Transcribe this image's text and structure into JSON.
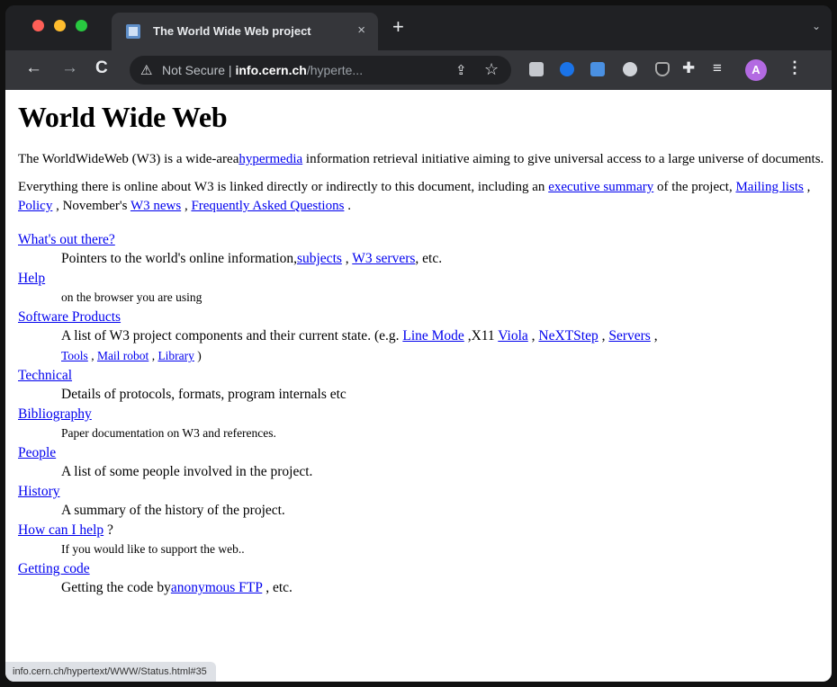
{
  "browser": {
    "tab_title": "The World Wide Web project",
    "tab_close": "×",
    "new_tab": "+",
    "tab_search": "⌄",
    "omnibox": {
      "warning_icon": "warning-triangle-icon",
      "not_secure": "Not Secure",
      "separator": " | ",
      "host": "info.cern.ch",
      "path": "/hyperte..."
    },
    "avatar_letter": "A"
  },
  "page": {
    "title": "World Wide Web",
    "intro": {
      "t1": "The WorldWideWeb (W3) is a wide-area",
      "link_hypermedia": "hypermedia",
      "t2": " information retrieval initiative aiming to give universal access to a large universe of documents."
    },
    "para2": {
      "t1": "Everything there is online about W3 is linked directly or indirectly to this document, including an ",
      "link_exec": "executive summary",
      "t2": " of the project, ",
      "link_mailing": "Mailing lists",
      "t3": " , ",
      "link_policy": "Policy",
      "t4": " , November's ",
      "link_news": "W3 news",
      "t5": " , ",
      "link_faq": "Frequently Asked Questions",
      "t6": " ."
    },
    "items": [
      {
        "label": "What's out there?"
      },
      {
        "label": "Help",
        "desc": "on the browser you are using"
      },
      {
        "label": "Software Products"
      },
      {
        "label": "Technical",
        "desc": "Details of protocols, formats, program internals etc"
      },
      {
        "label": "Bibliography",
        "desc": "Paper documentation on W3 and references."
      },
      {
        "label": "People",
        "desc": "A list of some people involved in the project."
      },
      {
        "label": "History",
        "desc": "A summary of the history of the project."
      },
      {
        "label": "How can I help",
        "after": " ?",
        "desc": "If you would like to support the web.."
      },
      {
        "label": "Getting code"
      }
    ],
    "whats_out": {
      "t1": "Pointers to the world's online information,",
      "link_subjects": "subjects",
      "t2": " , ",
      "link_servers": "W3 servers",
      "t3": ", etc."
    },
    "software": {
      "t1": "A list of W3 project components and their current state. (e.g. ",
      "link_linemode": "Line Mode",
      "t2": " ,X11 ",
      "link_viola": "Viola",
      "t3": " , ",
      "link_nextstep": "NeXTStep",
      "t4": " , ",
      "link_servers": "Servers",
      "t5": " , ",
      "link_tools": "Tools",
      "t6": " , ",
      "link_mailrobot": "Mail robot",
      "t7": " , ",
      "link_library": "Library",
      "t8": " )"
    },
    "getting_code": {
      "t1": "Getting the code by",
      "link_ftp": "anonymous FTP",
      "t2": " , etc."
    }
  },
  "status_url": "info.cern.ch/hypertext/WWW/Status.html#35"
}
